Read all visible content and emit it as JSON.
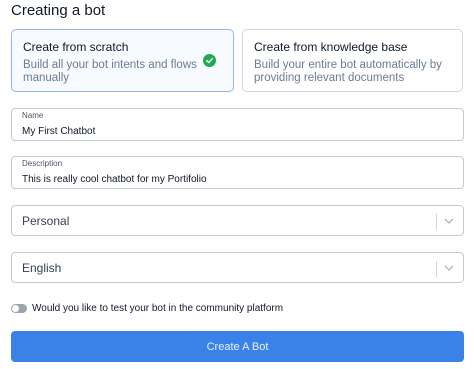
{
  "page": {
    "title": "Creating a bot"
  },
  "options": [
    {
      "title": "Create from scratch",
      "description": "Build all your bot intents and flows manually",
      "selected": true
    },
    {
      "title": "Create from knowledge base",
      "description": "Build your entire bot automatically by providing relevant documents",
      "selected": false
    }
  ],
  "form": {
    "name": {
      "label": "Name",
      "value": "My First Chatbot"
    },
    "description": {
      "label": "Description",
      "value": "This is really cool chatbot for my Portifolio"
    },
    "category": {
      "value": "Personal",
      "icon": "chevron-down-icon"
    },
    "language": {
      "value": "English",
      "icon": "chevron-down-icon"
    },
    "community_test": {
      "label": "Would you like to test your bot in the community platform",
      "enabled": false
    },
    "submit_label": "Create A Bot"
  },
  "colors": {
    "accent": "#3b82e8",
    "selected_check": "#1faa4f",
    "selected_border": "#93b6e8"
  }
}
